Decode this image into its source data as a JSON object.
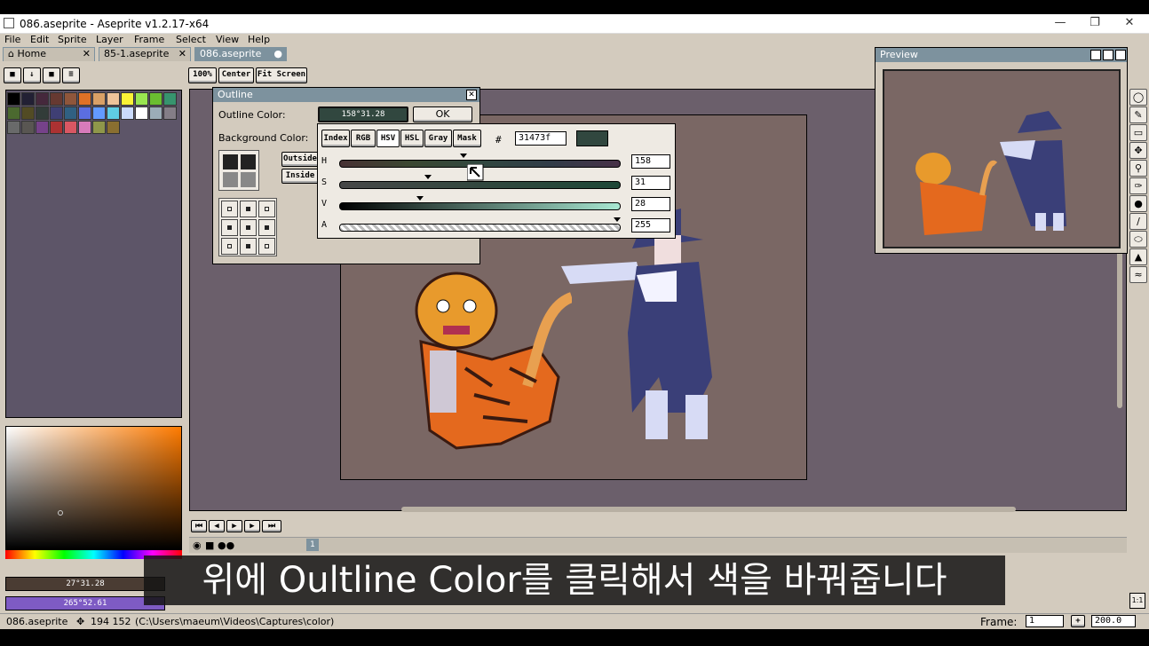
{
  "window": {
    "title": "086.aseprite - Aseprite v1.2.17-x64",
    "min": "—",
    "restore": "❐",
    "close": "✕"
  },
  "menu": [
    "File",
    "Edit",
    "Sprite",
    "Layer",
    "Frame",
    "Select",
    "View",
    "Help"
  ],
  "tabs": [
    {
      "label": "Home",
      "close": "✕"
    },
    {
      "label": "85-1.aseprite",
      "close": "✕"
    },
    {
      "label": "086.aseprite",
      "close": "●"
    }
  ],
  "zoom_buttons": [
    "100%",
    "Center",
    "Fit Screen"
  ],
  "outline_dialog": {
    "title": "Outline",
    "close": "✕",
    "outline_color_label": "Outline Color:",
    "outline_color_value": "158°31.28",
    "ok": "OK",
    "background_color_label": "Background Color:",
    "outside": "Outside",
    "inside": "Inside"
  },
  "color_popup": {
    "modes": [
      "Index",
      "RGB",
      "HSV",
      "HSL",
      "Gray",
      "Mask"
    ],
    "active_mode": "HSV",
    "hash": "#",
    "hex": "31473f",
    "swatch_color": "#31473f",
    "sliders": [
      {
        "label": "H",
        "value": "158",
        "level": 0.44
      },
      {
        "label": "S",
        "value": "31",
        "level": 0.31
      },
      {
        "label": "V",
        "value": "28",
        "level": 0.28
      },
      {
        "label": "A",
        "value": "255",
        "level": 1.0
      }
    ]
  },
  "fg_color_label": "27°31.28",
  "bg_color_label": "265°52.61",
  "preview": {
    "title": "Preview"
  },
  "timeline": {
    "frame_number": "1"
  },
  "status": {
    "file": "086.aseprite",
    "coords": "194 152",
    "path": "(C:\\Users\\maeum\\Videos\\Captures\\color)",
    "frame_label": "Frame:",
    "frame_value": "1",
    "zoom_value": "200.0"
  },
  "subtitle": "위에 Oultline Color를 클릭해서 색을 바꿔줍니다",
  "colors": {
    "accent": "#7d929e",
    "chrome": "#d3cbbe",
    "canvas_bg": "#6b5f6b"
  }
}
